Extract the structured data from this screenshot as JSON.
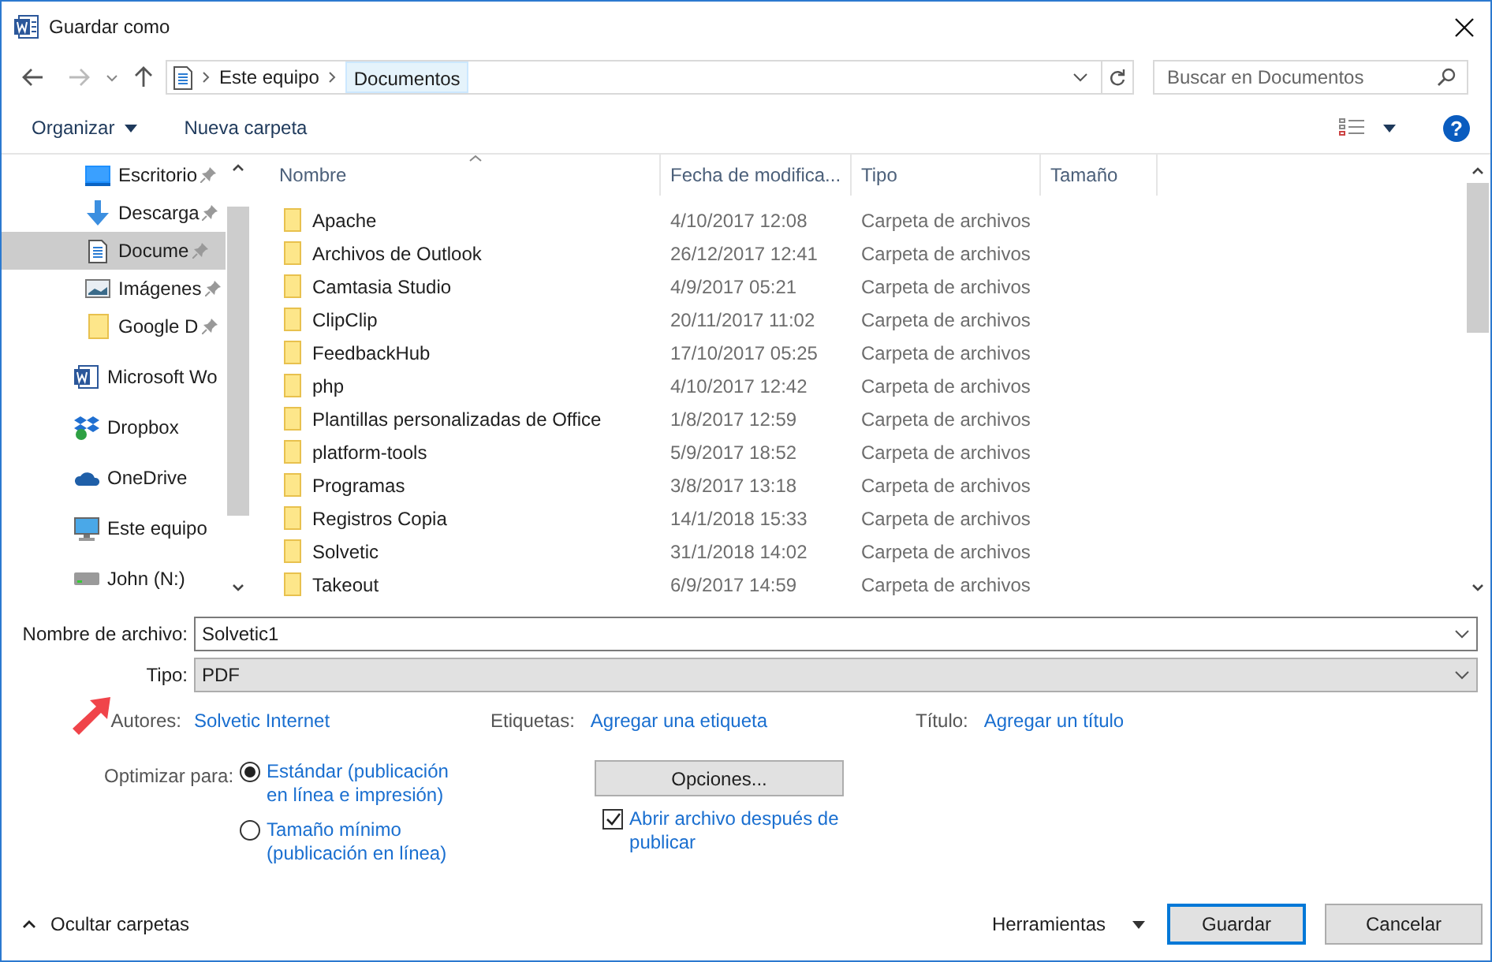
{
  "window": {
    "title": "Guardar como"
  },
  "address": {
    "crumbs": [
      "Este equipo",
      "Documentos"
    ],
    "search_placeholder": "Buscar en Documentos"
  },
  "toolbar": {
    "organize": "Organizar",
    "new_folder": "Nueva carpeta",
    "help": "?"
  },
  "sidebar": {
    "items": [
      {
        "label": "Escritorio",
        "kind": "desktop",
        "pinned": true,
        "selected": false
      },
      {
        "label": "Descarga",
        "kind": "download",
        "pinned": true,
        "selected": false
      },
      {
        "label": "Docume",
        "kind": "document",
        "pinned": true,
        "selected": true
      },
      {
        "label": "Imágenes",
        "kind": "images",
        "pinned": true,
        "selected": false
      },
      {
        "label": "Google D",
        "kind": "folder",
        "pinned": true,
        "selected": false
      },
      {
        "label": "Microsoft Wo",
        "kind": "word",
        "pinned": false,
        "selected": false
      },
      {
        "label": "Dropbox",
        "kind": "dropbox",
        "pinned": false,
        "selected": false
      },
      {
        "label": "OneDrive",
        "kind": "onedrive",
        "pinned": false,
        "selected": false
      },
      {
        "label": "Este equipo",
        "kind": "computer",
        "pinned": false,
        "selected": false
      },
      {
        "label": "John (N:)",
        "kind": "drive",
        "pinned": false,
        "selected": false
      }
    ]
  },
  "table": {
    "columns": [
      "Nombre",
      "Fecha de modifica...",
      "Tipo",
      "Tamaño"
    ],
    "rows": [
      {
        "name": "Apache",
        "date": "4/10/2017 12:08",
        "type": "Carpeta de archivos"
      },
      {
        "name": "Archivos de Outlook",
        "date": "26/12/2017 12:41",
        "type": "Carpeta de archivos"
      },
      {
        "name": "Camtasia Studio",
        "date": "4/9/2017 05:21",
        "type": "Carpeta de archivos"
      },
      {
        "name": "ClipClip",
        "date": "20/11/2017 11:02",
        "type": "Carpeta de archivos"
      },
      {
        "name": "FeedbackHub",
        "date": "17/10/2017 05:25",
        "type": "Carpeta de archivos"
      },
      {
        "name": "php",
        "date": "4/10/2017 12:42",
        "type": "Carpeta de archivos"
      },
      {
        "name": "Plantillas personalizadas de Office",
        "date": "1/8/2017 12:59",
        "type": "Carpeta de archivos"
      },
      {
        "name": "platform-tools",
        "date": "5/9/2017 18:52",
        "type": "Carpeta de archivos"
      },
      {
        "name": "Programas",
        "date": "3/8/2017 13:18",
        "type": "Carpeta de archivos"
      },
      {
        "name": "Registros Copia",
        "date": "14/1/2018 15:33",
        "type": "Carpeta de archivos"
      },
      {
        "name": "Solvetic",
        "date": "31/1/2018 14:02",
        "type": "Carpeta de archivos"
      },
      {
        "name": "Takeout",
        "date": "6/9/2017 14:59",
        "type": "Carpeta de archivos"
      }
    ]
  },
  "file_name": {
    "label": "Nombre de archivo:",
    "value": "Solvetic1"
  },
  "file_type": {
    "label": "Tipo:",
    "value": "PDF"
  },
  "metadata": [
    {
      "label": "Autores:",
      "value": "Solvetic Internet"
    },
    {
      "label": "Etiquetas:",
      "value": "Agregar una etiqueta"
    },
    {
      "label": "Título:",
      "value": "Agregar un título"
    }
  ],
  "optimize": {
    "label": "Optimizar para:",
    "options": [
      {
        "label": "Estándar (publicación en línea e impresión)",
        "selected": true
      },
      {
        "label": "Tamaño mínimo (publicación en línea)",
        "selected": false
      }
    ]
  },
  "options_button": "Opciones...",
  "open_after": {
    "label": "Abrir archivo después de publicar",
    "checked": true
  },
  "hide_folders": "Ocultar carpetas",
  "tools": "Herramientas",
  "buttons": [
    {
      "label": "Guardar",
      "default": true
    },
    {
      "label": "Cancelar",
      "default": false
    }
  ]
}
